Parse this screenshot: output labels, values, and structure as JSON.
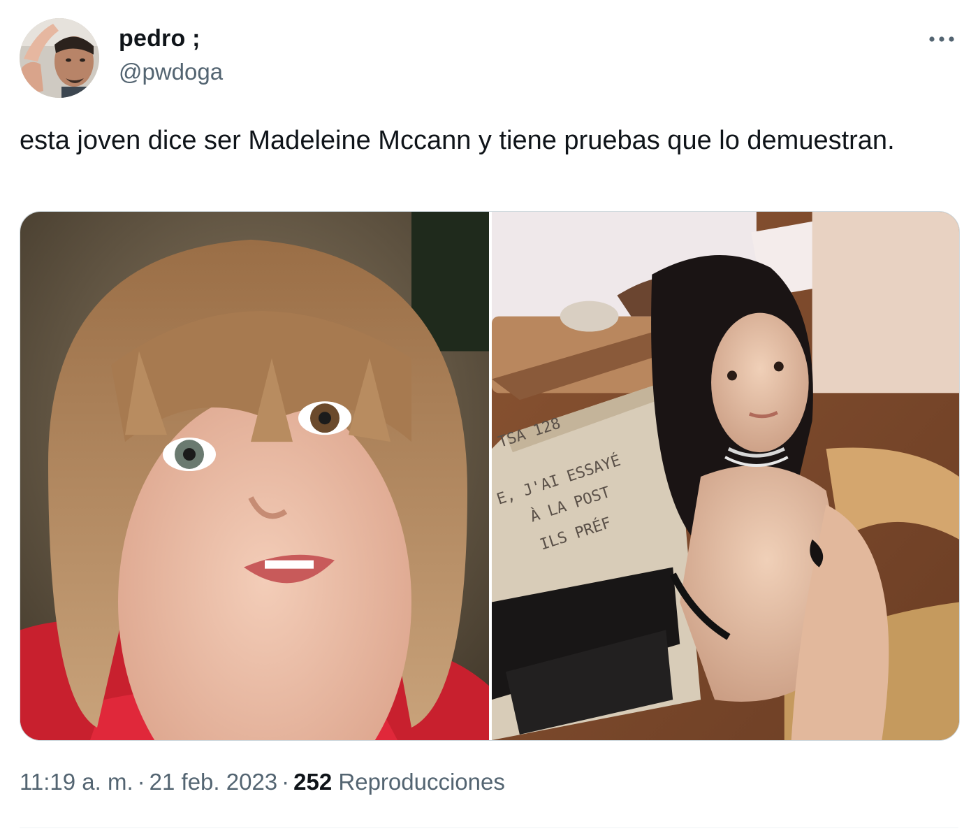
{
  "author": {
    "display_name": "pedro ;",
    "handle": "@pwdoga"
  },
  "tweet": {
    "text": "esta joven dice ser Madeleine Mccann y tiene pruebas que lo demuestran."
  },
  "media": {
    "right_image_text": {
      "line1": "TSA 128",
      "line2": "E, J'AI ESSAYÉ",
      "line3": "À LA POST",
      "line4": "ILS PRÉF"
    }
  },
  "meta": {
    "time": "11:19 a. m.",
    "separator": "·",
    "date": "21 feb. 2023",
    "views_count": "252",
    "views_label": "Reproducciones"
  },
  "icons": {
    "more": "more-horizontal-icon"
  },
  "colors": {
    "text_primary": "#0f1419",
    "text_secondary": "#536471",
    "border": "#cfd9de"
  }
}
